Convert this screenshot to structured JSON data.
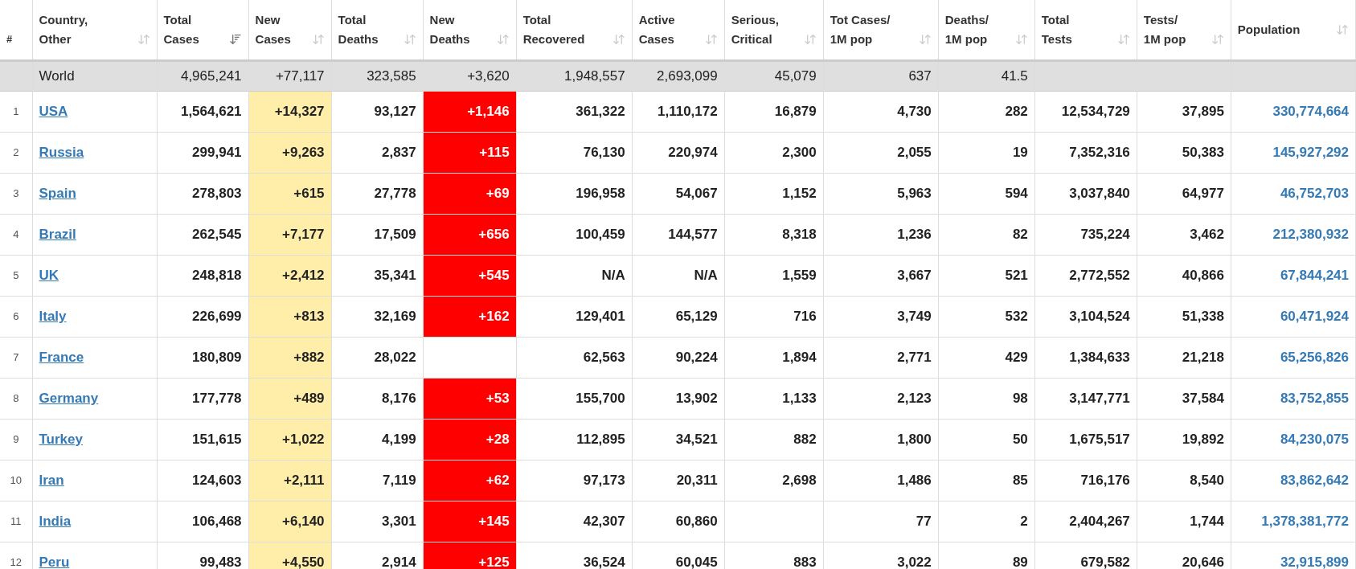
{
  "table": {
    "columns": [
      {
        "kind": "index",
        "lines": [
          "#"
        ]
      },
      {
        "kind": "country",
        "lines": [
          "Country,",
          "Other"
        ],
        "sorted": false
      },
      {
        "kind": "number",
        "lines": [
          "Total",
          "Cases"
        ],
        "sorted": true
      },
      {
        "kind": "new_cases",
        "lines": [
          "New",
          "Cases"
        ],
        "sorted": false
      },
      {
        "kind": "number",
        "lines": [
          "Total",
          "Deaths"
        ],
        "sorted": false
      },
      {
        "kind": "new_deaths",
        "lines": [
          "New",
          "Deaths"
        ],
        "sorted": false
      },
      {
        "kind": "number",
        "lines": [
          "Total",
          "Recovered"
        ],
        "sorted": false
      },
      {
        "kind": "number",
        "lines": [
          "Active",
          "Cases"
        ],
        "sorted": false
      },
      {
        "kind": "number",
        "lines": [
          "Serious,",
          "Critical"
        ],
        "sorted": false
      },
      {
        "kind": "number",
        "lines": [
          "Tot Cases/",
          "1M pop"
        ],
        "sorted": false
      },
      {
        "kind": "number",
        "lines": [
          "Deaths/",
          "1M pop"
        ],
        "sorted": false
      },
      {
        "kind": "number",
        "lines": [
          "Total",
          "Tests"
        ],
        "sorted": false
      },
      {
        "kind": "number",
        "lines": [
          "Tests/",
          "1M pop"
        ],
        "sorted": false
      },
      {
        "kind": "population",
        "lines": [
          "Population"
        ],
        "sorted": false
      }
    ],
    "world": {
      "label": "World",
      "values": [
        "4,965,241",
        "+77,117",
        "323,585",
        "+3,620",
        "1,948,557",
        "2,693,099",
        "45,079",
        "637",
        "41.5"
      ]
    },
    "rows": [
      [
        "1",
        "USA",
        "1,564,621",
        "+14,327",
        "93,127",
        "+1,146",
        "361,322",
        "1,110,172",
        "16,879",
        "4,730",
        "282",
        "12,534,729",
        "37,895",
        "330,774,664"
      ],
      [
        "2",
        "Russia",
        "299,941",
        "+9,263",
        "2,837",
        "+115",
        "76,130",
        "220,974",
        "2,300",
        "2,055",
        "19",
        "7,352,316",
        "50,383",
        "145,927,292"
      ],
      [
        "3",
        "Spain",
        "278,803",
        "+615",
        "27,778",
        "+69",
        "196,958",
        "54,067",
        "1,152",
        "5,963",
        "594",
        "3,037,840",
        "64,977",
        "46,752,703"
      ],
      [
        "4",
        "Brazil",
        "262,545",
        "+7,177",
        "17,509",
        "+656",
        "100,459",
        "144,577",
        "8,318",
        "1,236",
        "82",
        "735,224",
        "3,462",
        "212,380,932"
      ],
      [
        "5",
        "UK",
        "248,818",
        "+2,412",
        "35,341",
        "+545",
        "N/A",
        "N/A",
        "1,559",
        "3,667",
        "521",
        "2,772,552",
        "40,866",
        "67,844,241"
      ],
      [
        "6",
        "Italy",
        "226,699",
        "+813",
        "32,169",
        "+162",
        "129,401",
        "65,129",
        "716",
        "3,749",
        "532",
        "3,104,524",
        "51,338",
        "60,471,924"
      ],
      [
        "7",
        "France",
        "180,809",
        "+882",
        "28,022",
        null,
        "62,563",
        "90,224",
        "1,894",
        "2,771",
        "429",
        "1,384,633",
        "21,218",
        "65,256,826"
      ],
      [
        "8",
        "Germany",
        "177,778",
        "+489",
        "8,176",
        "+53",
        "155,700",
        "13,902",
        "1,133",
        "2,123",
        "98",
        "3,147,771",
        "37,584",
        "83,752,855"
      ],
      [
        "9",
        "Turkey",
        "151,615",
        "+1,022",
        "4,199",
        "+28",
        "112,895",
        "34,521",
        "882",
        "1,800",
        "50",
        "1,675,517",
        "19,892",
        "84,230,075"
      ],
      [
        "10",
        "Iran",
        "124,603",
        "+2,111",
        "7,119",
        "+62",
        "97,173",
        "20,311",
        "2,698",
        "1,486",
        "85",
        "716,176",
        "8,540",
        "83,862,642"
      ],
      [
        "11",
        "India",
        "106,468",
        "+6,140",
        "3,301",
        "+145",
        "42,307",
        "60,860",
        null,
        "77",
        "2",
        "2,404,267",
        "1,744",
        "1,378,381,772"
      ],
      [
        "12",
        "Peru",
        "99,483",
        "+4,550",
        "2,914",
        "+125",
        "36,524",
        "60,045",
        "883",
        "3,022",
        "89",
        "679,582",
        "20,646",
        "32,915,899"
      ]
    ]
  }
}
